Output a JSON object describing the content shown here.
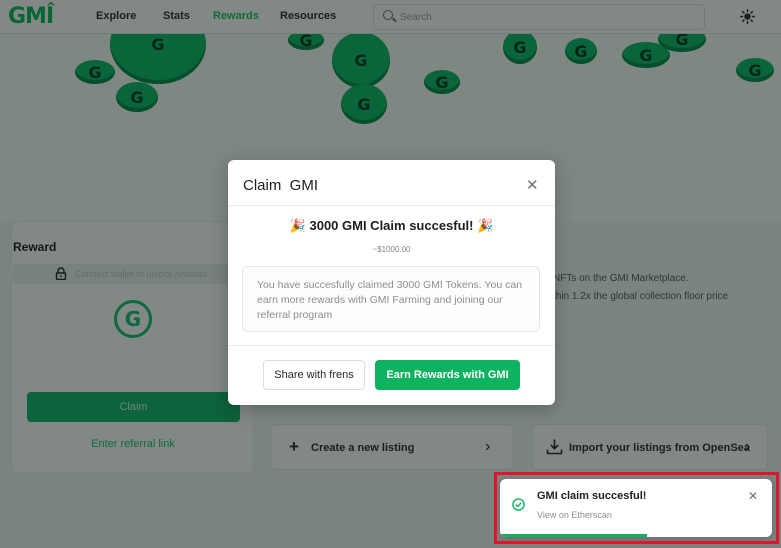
{
  "nav": {
    "logo": "GMI",
    "links": [
      "Explore",
      "Stats",
      "Rewards",
      "Resources"
    ],
    "active_link": "Rewards",
    "search_placeholder": "Search"
  },
  "reward_panel": {
    "title": "Reward",
    "lock_text": "Connect wallet to unlock rewards",
    "claim_label": "Claim",
    "referral_label": "Enter referral link"
  },
  "listings": {
    "info_line_1": "NFTs on the GMI Marketplace.",
    "info_line_2": "thin 1.2x the global collection floor price",
    "create_label": "Create a new listing",
    "import_label": "Import your listings from OpenSea"
  },
  "modal": {
    "title": "Claim  GMI",
    "close_icon": "close-icon",
    "headline_emoji": "🎉",
    "headline": "3000 GMI Claim succesful!",
    "usd_value": "~$1000.00",
    "message": "You have succesfully claimed 3000 GMI Tokens. You can earn more rewards with GMI Farming and joining our referral program",
    "share_label": "Share with frens",
    "earn_label": "Earn Rewards with GMI"
  },
  "toast": {
    "title": "GMI claim succesful!",
    "link": "View on Etherscan",
    "progress": 0.54
  },
  "colors": {
    "brand_green": "#0eb360",
    "highlight_red": "#e0142a"
  }
}
